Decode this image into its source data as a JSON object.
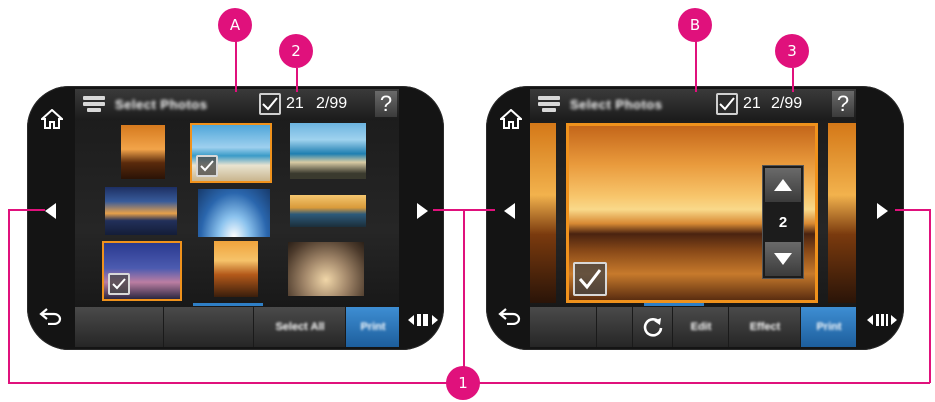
{
  "callouts": {
    "a": "A",
    "b": "B",
    "two": "2",
    "three": "3",
    "one": "1"
  },
  "left_screen": {
    "title": "Select Photos",
    "count": "21",
    "position": "2/99",
    "help": "?",
    "bottom_bar": {
      "select_all": "Select All",
      "print": "Print"
    }
  },
  "right_screen": {
    "title": "Select Photos",
    "count": "21",
    "position": "2/99",
    "help": "?",
    "copies": "2",
    "bottom_bar": {
      "edit": "Edit",
      "effect": "Effect",
      "print": "Print"
    }
  },
  "icons": [
    "home-icon",
    "printer-icon",
    "check-icon",
    "help-icon",
    "left-arrow-icon",
    "right-arrow-icon",
    "back-icon",
    "scroll-icon",
    "rotate-icon",
    "up-arrow-icon",
    "down-arrow-icon"
  ],
  "colors": {
    "callout": "#e0117c",
    "selection": "#f0921c",
    "accent": "#2f7fc6"
  }
}
